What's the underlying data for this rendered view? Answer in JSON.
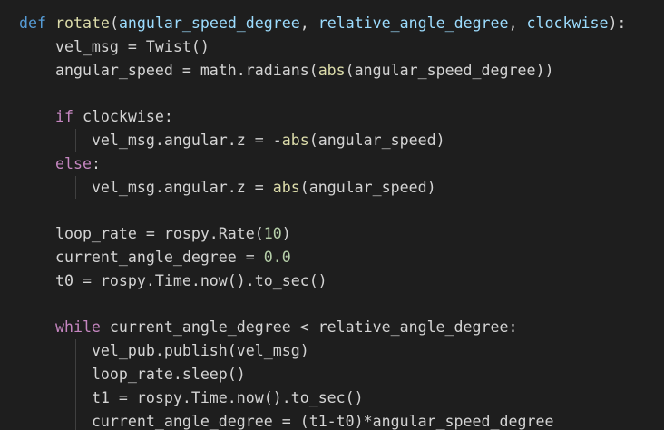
{
  "editor": {
    "language": "python",
    "theme_background": "#1e1e1e",
    "colors": {
      "keyword": "#569cd6",
      "control": "#c586c0",
      "function": "#dcdcaa",
      "parameter": "#9cdcfe",
      "number": "#b5cea8",
      "text": "#d4d4d4"
    },
    "lines": [
      {
        "indent": 0,
        "tokens": [
          {
            "t": "def",
            "c": "kw"
          },
          {
            "t": " ",
            "c": "var"
          },
          {
            "t": "rotate",
            "c": "fn"
          },
          {
            "t": "(",
            "c": "op"
          },
          {
            "t": "angular_speed_degree",
            "c": "par"
          },
          {
            "t": ", ",
            "c": "op"
          },
          {
            "t": "relative_angle_degree",
            "c": "par"
          },
          {
            "t": ", ",
            "c": "op"
          },
          {
            "t": "clockwise",
            "c": "par"
          },
          {
            "t": "):",
            "c": "op"
          }
        ]
      },
      {
        "indent": 1,
        "tokens": [
          {
            "t": "vel_msg = Twist()",
            "c": "var"
          }
        ]
      },
      {
        "indent": 1,
        "tokens": [
          {
            "t": "angular_speed = math.radians(",
            "c": "var"
          },
          {
            "t": "abs",
            "c": "fn"
          },
          {
            "t": "(angular_speed_degree))",
            "c": "var"
          }
        ]
      },
      {
        "indent": 0,
        "tokens": []
      },
      {
        "indent": 1,
        "tokens": [
          {
            "t": "if",
            "c": "ctl"
          },
          {
            "t": " clockwise:",
            "c": "var"
          }
        ]
      },
      {
        "indent": 2,
        "tokens": [
          {
            "t": "vel_msg.angular.z = -",
            "c": "var"
          },
          {
            "t": "abs",
            "c": "fn"
          },
          {
            "t": "(angular_speed)",
            "c": "var"
          }
        ]
      },
      {
        "indent": 1,
        "tokens": [
          {
            "t": "else",
            "c": "ctl"
          },
          {
            "t": ":",
            "c": "var"
          }
        ]
      },
      {
        "indent": 2,
        "tokens": [
          {
            "t": "vel_msg.angular.z = ",
            "c": "var"
          },
          {
            "t": "abs",
            "c": "fn"
          },
          {
            "t": "(angular_speed)",
            "c": "var"
          }
        ]
      },
      {
        "indent": 0,
        "tokens": []
      },
      {
        "indent": 1,
        "tokens": [
          {
            "t": "loop_rate = rospy.Rate(",
            "c": "var"
          },
          {
            "t": "10",
            "c": "num"
          },
          {
            "t": ")",
            "c": "var"
          }
        ]
      },
      {
        "indent": 1,
        "tokens": [
          {
            "t": "current_angle_degree = ",
            "c": "var"
          },
          {
            "t": "0.0",
            "c": "num"
          }
        ]
      },
      {
        "indent": 1,
        "tokens": [
          {
            "t": "t0 = rospy.Time.now().to_sec()",
            "c": "var"
          }
        ]
      },
      {
        "indent": 0,
        "tokens": []
      },
      {
        "indent": 1,
        "tokens": [
          {
            "t": "while",
            "c": "ctl"
          },
          {
            "t": " current_angle_degree < relative_angle_degree:",
            "c": "var"
          }
        ]
      },
      {
        "indent": 2,
        "tokens": [
          {
            "t": "vel_pub.publish(vel_msg)",
            "c": "var"
          }
        ]
      },
      {
        "indent": 2,
        "tokens": [
          {
            "t": "loop_rate.sleep()",
            "c": "var"
          }
        ]
      },
      {
        "indent": 2,
        "tokens": [
          {
            "t": "t1 = rospy.Time.now().to_sec()",
            "c": "var"
          }
        ]
      },
      {
        "indent": 2,
        "tokens": [
          {
            "t": "current_angle_degree = (t1-t0)*angular_speed_degree",
            "c": "var"
          }
        ]
      }
    ]
  }
}
